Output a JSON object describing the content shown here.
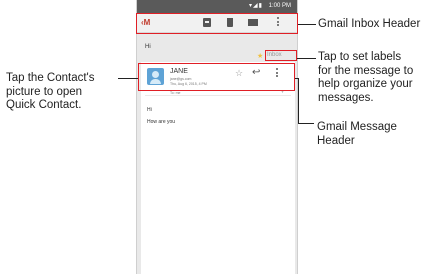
{
  "statusbar": {
    "time": "1:00 PM"
  },
  "email": {
    "subject": "Hi",
    "label": "Inbox",
    "sender_name": "JANE",
    "sender_email": "jane@gs.com",
    "date": "Thu, Aug 6, 2015, 4 PM",
    "to_line": "To: me",
    "body_line1": "Hi",
    "body_line2": "How are you"
  },
  "annotations": {
    "inbox_header": "Gmail Inbox Header",
    "labels_tip": [
      "Tap to set labels",
      "for the message to",
      "help organize your",
      "messages."
    ],
    "message_header": [
      "Gmail Message",
      "Header"
    ],
    "contact_tip": [
      "Tap the Contact's",
      "picture to open",
      "Quick Contact."
    ]
  },
  "colors": {
    "highlight": "#e01f26",
    "avatar": "#5ea3d6"
  },
  "icons": [
    "back-icon",
    "archive-icon",
    "delete-icon",
    "mail-icon",
    "more-icon",
    "star-icon",
    "reply-icon"
  ]
}
